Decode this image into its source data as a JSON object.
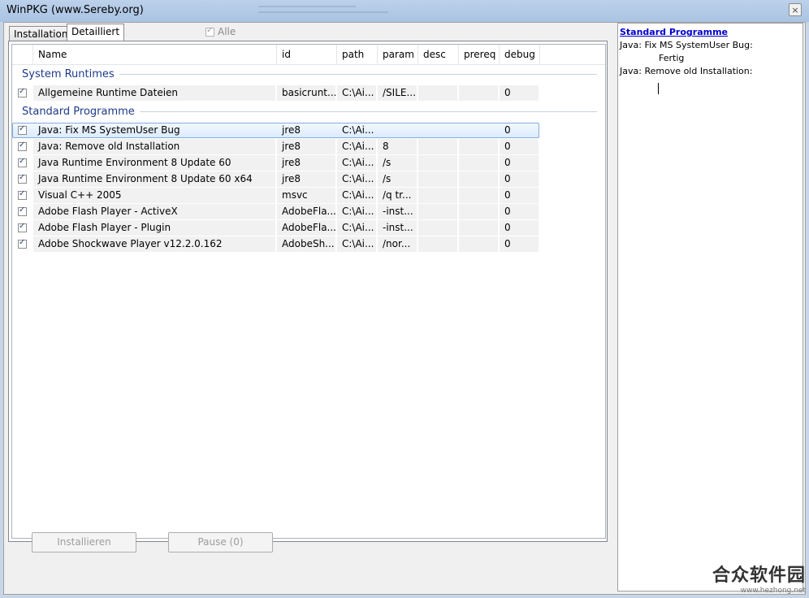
{
  "window": {
    "title": "WinPKG (www.Sereby.org)",
    "close_label": "×"
  },
  "tabs": [
    {
      "label": "Installation"
    },
    {
      "label": "Detailliert"
    }
  ],
  "alle": {
    "label": "Alle",
    "checked": true
  },
  "list": {
    "columns": [
      "Name",
      "id",
      "path",
      "param",
      "desc",
      "prereq",
      "debug"
    ],
    "groups": [
      {
        "label": "System Runtimes",
        "rows": [
          {
            "name": "Allgemeine Runtime Dateien",
            "id": "basicrunt...",
            "path": "C:\\Ai...",
            "param": "/SILE...",
            "desc": "",
            "prereq": "",
            "debug": "0"
          }
        ]
      },
      {
        "label": "Standard Programme",
        "rows": [
          {
            "name": "Java: Fix MS SystemUser Bug",
            "id": "jre8",
            "path": "C:\\Ai...",
            "param": "",
            "desc": "",
            "prereq": "",
            "debug": "0"
          },
          {
            "name": "Java: Remove old Installation",
            "id": "jre8",
            "path": "C:\\Ai...",
            "param": "8",
            "desc": "",
            "prereq": "",
            "debug": "0"
          },
          {
            "name": "Java Runtime Environment 8 Update 60",
            "id": "jre8",
            "path": "C:\\Ai...",
            "param": "/s",
            "desc": "",
            "prereq": "",
            "debug": "0"
          },
          {
            "name": "Java Runtime Environment 8 Update 60 x64",
            "id": "jre8",
            "path": "C:\\Ai...",
            "param": "/s",
            "desc": "",
            "prereq": "",
            "debug": "0"
          },
          {
            "name": "Visual C++ 2005",
            "id": "msvc",
            "path": "C:\\Ai...",
            "param": "/q tr...",
            "desc": "",
            "prereq": "",
            "debug": "0"
          },
          {
            "name": "Adobe Flash Player - ActiveX",
            "id": "AdobeFla...",
            "path": "C:\\Ai...",
            "param": "-inst...",
            "desc": "",
            "prereq": "",
            "debug": "0"
          },
          {
            "name": "Adobe Flash Player - Plugin",
            "id": "AdobeFla...",
            "path": "C:\\Ai...",
            "param": "-inst...",
            "desc": "",
            "prereq": "",
            "debug": "0"
          },
          {
            "name": "Adobe Shockwave Player v12.2.0.162",
            "id": "AdobeSh...",
            "path": "C:\\Ai...",
            "param": "/nor...",
            "desc": "",
            "prereq": "",
            "debug": "0"
          }
        ]
      }
    ]
  },
  "buttons": {
    "install": "Installieren",
    "pause": "Pause (0)"
  },
  "log": {
    "title": "Standard Programme",
    "lines": [
      {
        "text": "Java: Fix MS SystemUser Bug:"
      },
      {
        "text": "Fertig",
        "indent": true
      },
      {
        "text": "Java: Remove old Installation:"
      }
    ]
  },
  "watermark": {
    "main": "合众软件园",
    "sub": "www.hezhong.net"
  }
}
